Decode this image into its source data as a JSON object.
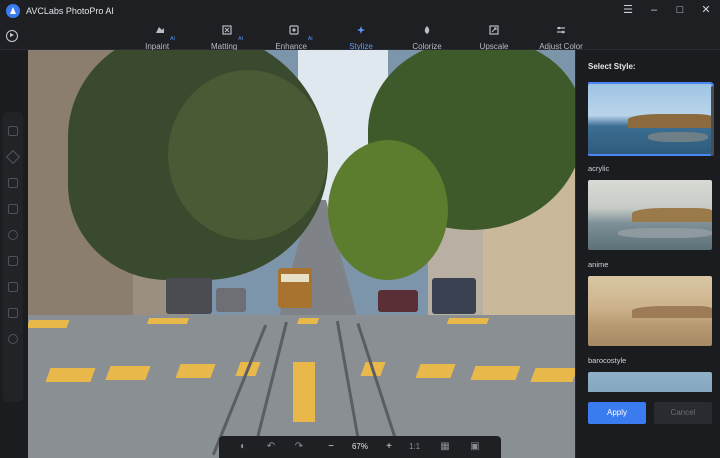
{
  "app": {
    "title": "AVCLabs PhotoPro AI"
  },
  "colors": {
    "accent": "#3a7bf0",
    "active_tab": "#5a9bff",
    "background": "#1b1c1f"
  },
  "toolbar": {
    "tabs": [
      {
        "label": "Inpaint",
        "ai": "AI",
        "icon": "inpaint-icon"
      },
      {
        "label": "Matting",
        "ai": "AI",
        "icon": "matting-icon"
      },
      {
        "label": "Enhance",
        "ai": "AI",
        "icon": "enhance-icon"
      },
      {
        "label": "Stylize",
        "ai": "",
        "icon": "stylize-icon",
        "active": true
      },
      {
        "label": "Colorize",
        "ai": "",
        "icon": "colorize-icon"
      },
      {
        "label": "Upscale",
        "ai": "",
        "icon": "upscale-icon"
      },
      {
        "label": "Adjust Color",
        "ai": "",
        "icon": "adjust-color-icon"
      }
    ]
  },
  "zoom": {
    "level": "67%",
    "fit": "1:1"
  },
  "panel": {
    "title": "Select Style:",
    "styles": [
      {
        "label": "acrylic",
        "selected": true
      },
      {
        "label": "anime",
        "selected": false
      },
      {
        "label": "barocostyle",
        "selected": false
      },
      {
        "label": "",
        "selected": false
      }
    ],
    "apply_label": "Apply",
    "cancel_label": "Cancel"
  }
}
